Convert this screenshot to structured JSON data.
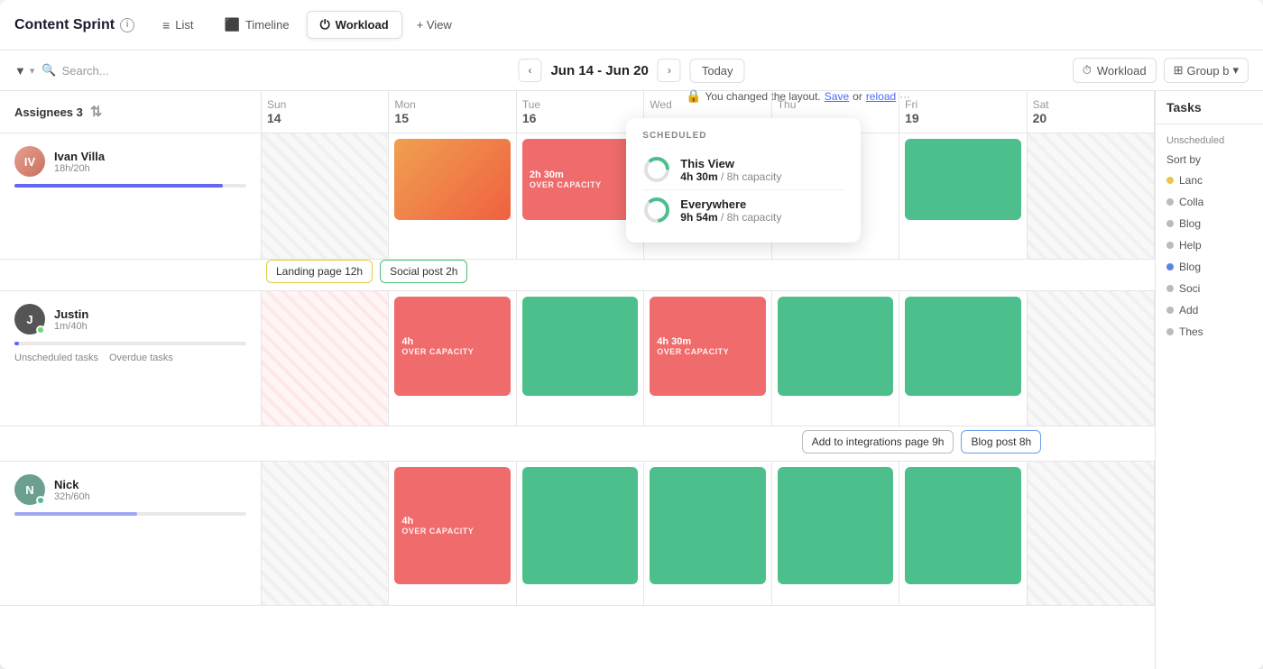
{
  "header": {
    "project_title": "Content Sprint",
    "tabs": [
      {
        "id": "list",
        "label": "List",
        "icon": "≡",
        "active": false
      },
      {
        "id": "timeline",
        "label": "Timeline",
        "icon": "▦",
        "active": false
      },
      {
        "id": "workload",
        "label": "Workload",
        "icon": "⏻",
        "active": true
      }
    ],
    "add_view": "+ View"
  },
  "toolbar": {
    "filter_label": "▼",
    "search_placeholder": "Search...",
    "date_range": "Jun 14 - Jun 20",
    "today_label": "Today",
    "workload_label": "Workload",
    "group_by_label": "Group b",
    "layout_message": "You changed the layout.",
    "save_label": "Save",
    "reload_label": "reload"
  },
  "calendar": {
    "assignees_header": "Assignees 3",
    "days": [
      {
        "name": "Sun",
        "num": "14"
      },
      {
        "name": "Mon",
        "num": "15"
      },
      {
        "name": "Tue",
        "num": "16"
      },
      {
        "name": "Wed",
        "num": ""
      },
      {
        "name": "Thu",
        "num": ""
      },
      {
        "name": "Fri",
        "num": "19"
      },
      {
        "name": "Sat",
        "num": "20"
      }
    ],
    "assignees": [
      {
        "id": "ivan",
        "name": "Ivan Villa",
        "hours": "18h/20h",
        "progress": 90,
        "avatar_initials": "IV",
        "avatar_class": "ivan",
        "has_status": false,
        "cells": [
          "hatched",
          "orange",
          "red",
          "teal",
          "",
          "teal",
          "hatched"
        ],
        "cell_labels": [
          "",
          "",
          "2h 30m\nOVER CAPACITY",
          "",
          "",
          "",
          ""
        ],
        "task_chips": [
          {
            "label": "Landing page 12h",
            "style": "yellow-outline",
            "col": 1
          },
          {
            "label": "Social post 2h",
            "style": "green-outline",
            "col": 1
          }
        ]
      },
      {
        "id": "justin",
        "name": "Justin",
        "hours": "1m/40h",
        "progress": 2,
        "avatar_initials": "J",
        "avatar_class": "justin",
        "has_status": true,
        "status_class": "justin-status",
        "cells": [
          "light-pink",
          "red",
          "teal",
          "red",
          "teal",
          "teal",
          "hatched"
        ],
        "cell_labels": [
          "",
          "4h\nOVER CAPACITY",
          "",
          "4h 30m\nOVER CAPACITY",
          "",
          "",
          ""
        ],
        "task_chips": [
          {
            "label": "Add to integrations page 9h",
            "style": "gray-outline",
            "col": 4
          },
          {
            "label": "Blog post 8h",
            "style": "blue-outline",
            "col": 4
          }
        ]
      },
      {
        "id": "nick",
        "name": "Nick",
        "hours": "32h/60h",
        "progress": 53,
        "avatar_initials": "N",
        "avatar_class": "nick",
        "has_status": true,
        "status_class": "nick-status",
        "cells": [
          "hatched",
          "red",
          "teal",
          "teal",
          "teal",
          "teal",
          "hatched"
        ],
        "cell_labels": [
          "",
          "4h\nOVER CAPACITY",
          "",
          "",
          "",
          "",
          ""
        ]
      }
    ],
    "popup": {
      "label": "SCHEDULED",
      "items": [
        {
          "view_name": "This View",
          "hours": "4h 30m",
          "capacity": "8h capacity"
        },
        {
          "view_name": "Everywhere",
          "hours": "9h 54m",
          "capacity": "8h capacity"
        }
      ]
    }
  },
  "tasks_sidebar": {
    "header": "Tasks",
    "unscheduled": "Unscheduled",
    "sort_by": "Sort by",
    "items": [
      {
        "label": "Lanc",
        "dot": "yellow"
      },
      {
        "label": "Colla",
        "dot": "gray"
      },
      {
        "label": "Blog",
        "dot": "gray"
      },
      {
        "label": "Help",
        "dot": "gray"
      },
      {
        "label": "Blog",
        "dot": "blue"
      },
      {
        "label": "Soci",
        "dot": "gray"
      },
      {
        "label": "Add",
        "dot": "gray"
      },
      {
        "label": "Thes",
        "dot": "gray"
      }
    ]
  }
}
